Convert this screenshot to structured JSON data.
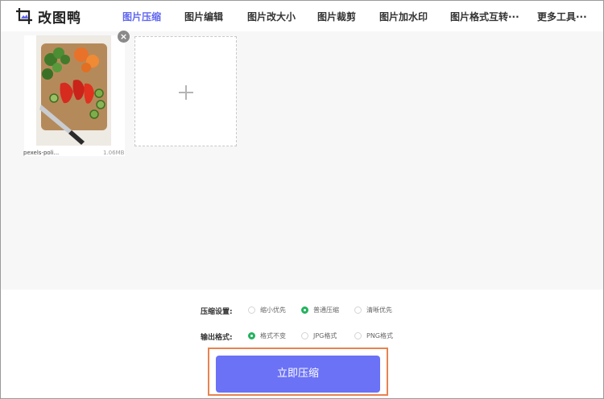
{
  "app": {
    "logo_text": "改图鸭",
    "logo_icon": "crop-image-icon"
  },
  "nav": {
    "items": [
      {
        "label": "图片压缩",
        "active": true
      },
      {
        "label": "图片编辑",
        "active": false
      },
      {
        "label": "图片改大小",
        "active": false
      },
      {
        "label": "图片裁剪",
        "active": false
      },
      {
        "label": "图片加水印",
        "active": false
      },
      {
        "label": "图片格式互转···",
        "active": false
      },
      {
        "label": "更多工具···",
        "active": false
      }
    ]
  },
  "upload": {
    "files": [
      {
        "name": "pexels-poli...",
        "size": "1.06MB"
      }
    ],
    "add_icon": "plus-icon",
    "remove_icon": "close-icon"
  },
  "settings": {
    "compress_label": "压缩设置:",
    "compress_options": [
      {
        "label": "缩小优先",
        "checked": false
      },
      {
        "label": "普通压缩",
        "checked": true
      },
      {
        "label": "清晰优先",
        "checked": false
      }
    ],
    "format_label": "输出格式:",
    "format_options": [
      {
        "label": "格式不变",
        "checked": true
      },
      {
        "label": "JPG格式",
        "checked": false
      },
      {
        "label": "PNG格式",
        "checked": false
      }
    ]
  },
  "action": {
    "compress_now": "立即压缩"
  },
  "colors": {
    "accent": "#6b72f5",
    "nav_active": "#5f66f0",
    "radio_checked": "#22b35e",
    "highlight_outline": "#e8834f"
  }
}
